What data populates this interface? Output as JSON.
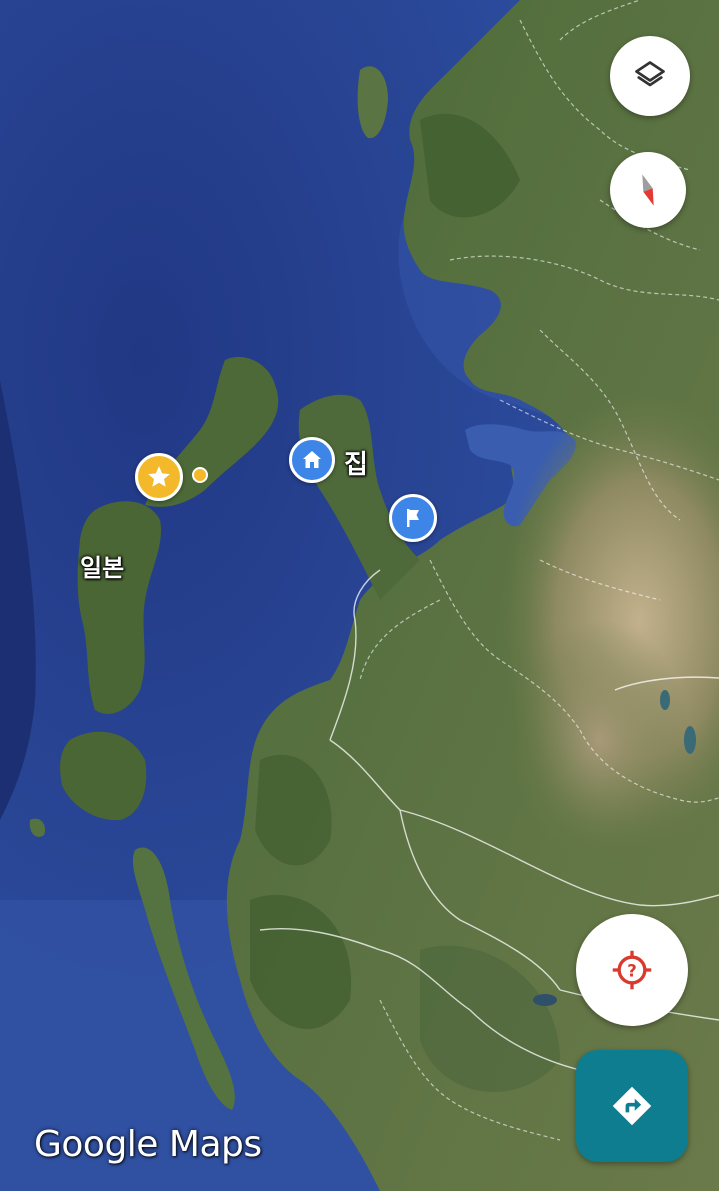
{
  "map": {
    "view": "satellite",
    "colors": {
      "ocean_deep": "#233b85",
      "ocean": "#2f4c9c",
      "ocean_shallow": "#4a6cc0",
      "land_dark": "#3b5a2e",
      "land": "#55703e",
      "land_light": "#7c8059",
      "mountain": "#b3a583",
      "border": "#ffffff"
    }
  },
  "controls": {
    "layers": {
      "icon": "layers-icon"
    },
    "compass": {
      "icon": "compass-icon"
    },
    "my_location": {
      "icon": "crosshair-question-icon",
      "color": "#d93a2e"
    },
    "directions": {
      "icon": "directions-icon",
      "color": "#0e7d8f"
    }
  },
  "markers": {
    "home": {
      "icon": "home-icon",
      "label": "집",
      "color": "#3d86e8"
    },
    "destination": {
      "icon": "flag-icon",
      "color": "#3d86e8"
    },
    "starred": {
      "icon": "star-icon",
      "color": "#f3b92b"
    }
  },
  "labels": {
    "country": "일본"
  },
  "branding": {
    "logo": "Google Maps"
  }
}
